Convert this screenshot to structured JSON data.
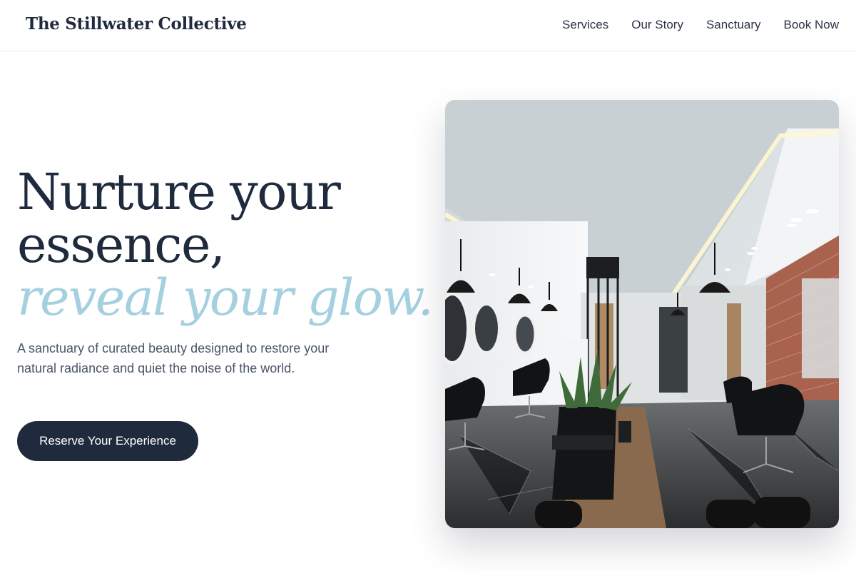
{
  "header": {
    "brand": "The Stillwater Collective",
    "nav": [
      "Services",
      "Our Story",
      "Sanctuary",
      "Book Now"
    ]
  },
  "hero": {
    "headline_line1": "Nurture your",
    "headline_line2": "essence,",
    "headline_accent": "reveal your glow.",
    "subtext": "A sanctuary of curated beauty designed to restore your natural radiance and quiet the noise of the world.",
    "cta_label": "Reserve Your Experience"
  },
  "colors": {
    "primary": "#1f2a3d",
    "accent": "#a4d0df",
    "body_text": "#4b5566"
  },
  "image": {
    "alt": "Modern salon interior with black chairs, pendant lamps, marble floor and brick wall"
  }
}
